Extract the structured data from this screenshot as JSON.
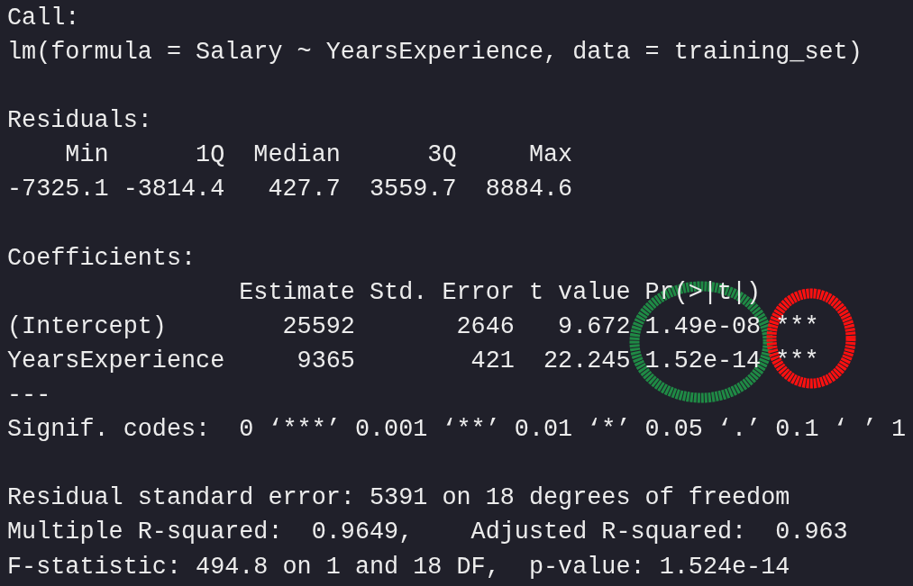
{
  "console": {
    "blocks": [
      {
        "lines": [
          "Call:",
          "lm(formula = Salary ~ YearsExperience, data = training_set)"
        ]
      },
      {
        "lines": [
          "Residuals:",
          "    Min      1Q  Median      3Q     Max",
          "-7325.1 -3814.4   427.7  3559.7  8884.6"
        ]
      },
      {
        "lines": [
          "Coefficients:",
          "                Estimate Std. Error t value Pr(>|t|)",
          "(Intercept)        25592       2646   9.672 1.49e-08 ***",
          "YearsExperience     9365        421  22.245 1.52e-14 ***",
          "---",
          "Signif. codes:  0 ‘***’ 0.001 ‘**’ 0.01 ‘*’ 0.05 ‘.’ 0.1 ‘ ’ 1"
        ]
      },
      {
        "lines": [
          "Residual standard error: 5391 on 18 degrees of freedom",
          "Multiple R-squared:  0.9649,    Adjusted R-squared:  0.963",
          "F-statistic: 494.8 on 1 and 18 DF,  p-value: 1.524e-14"
        ]
      }
    ]
  },
  "annotations": [
    {
      "kind": "circle",
      "color": "#1f8a45"
    },
    {
      "kind": "circle",
      "color": "#ff1010"
    }
  ]
}
